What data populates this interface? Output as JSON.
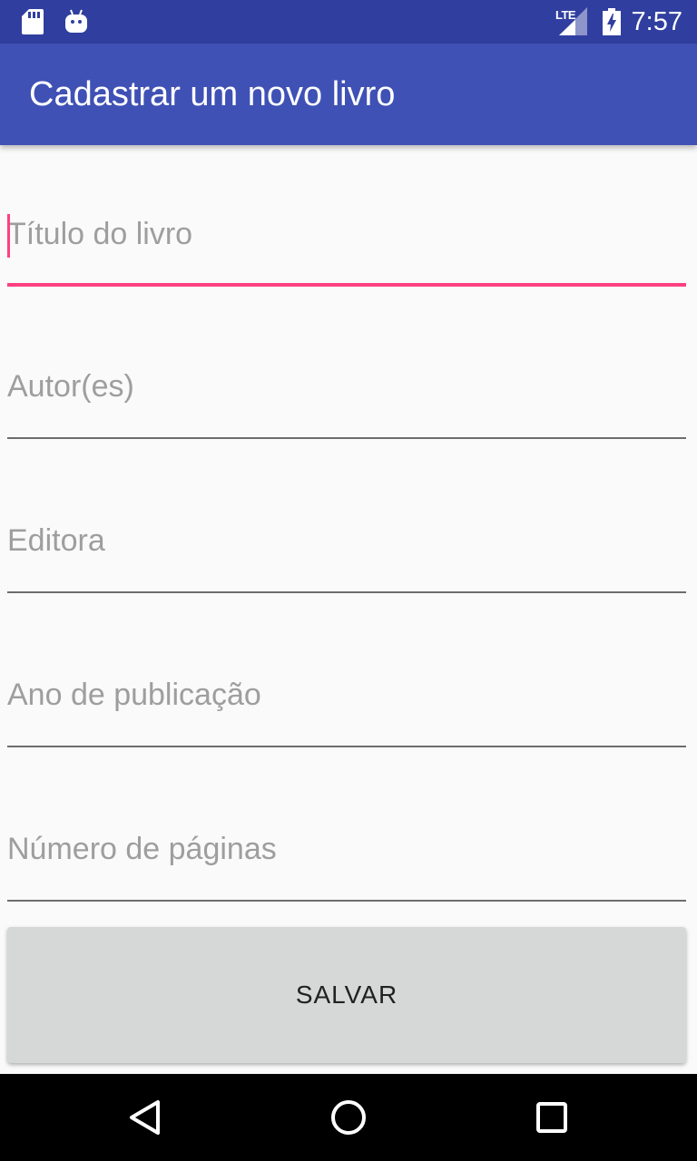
{
  "status_bar": {
    "time": "7:57",
    "network": "LTE",
    "icons": [
      "sd-card-icon",
      "android-icon",
      "signal-icon",
      "battery-charging-icon"
    ]
  },
  "app_bar": {
    "title": "Cadastrar um novo livro",
    "color": "#3f51b5"
  },
  "form": {
    "fields": [
      {
        "placeholder": "Título do livro",
        "value": "",
        "focused": true
      },
      {
        "placeholder": "Autor(es)",
        "value": "",
        "focused": false
      },
      {
        "placeholder": "Editora",
        "value": "",
        "focused": false
      },
      {
        "placeholder": "Ano de publicação",
        "value": "",
        "focused": false
      },
      {
        "placeholder": "Número de páginas",
        "value": "",
        "focused": false
      }
    ],
    "save_label": "SALVAR"
  },
  "colors": {
    "status_bar": "#303f9f",
    "primary": "#3f51b5",
    "accent": "#ff4081",
    "button": "#d6d7d7"
  },
  "nav_bar": {
    "buttons": [
      "back-icon",
      "home-icon",
      "recents-icon"
    ]
  }
}
